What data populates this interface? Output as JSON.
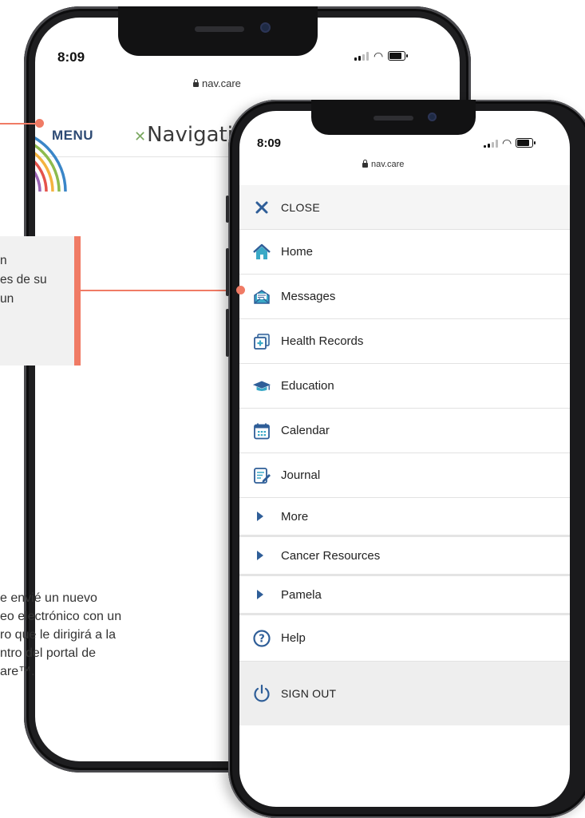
{
  "back_phone": {
    "time": "8:09",
    "url": "nav.care",
    "menu_label": "MENU",
    "logo_text": "Navigati"
  },
  "callouts": {
    "side_text_lines": [
      "n",
      "es de su",
      "un"
    ],
    "bottom_text_lines": [
      "e envié un nuevo",
      "eo electrónico con un",
      "ro que le dirigirá a la",
      "ntro del portal de",
      "are™."
    ]
  },
  "front_phone": {
    "time": "8:09",
    "url": "nav.care",
    "close_label": "CLOSE",
    "items": [
      {
        "label": "Home",
        "icon": "home-icon"
      },
      {
        "label": "Messages",
        "icon": "envelope-icon"
      },
      {
        "label": "Health Records",
        "icon": "health-records-icon"
      },
      {
        "label": "Education",
        "icon": "graduation-cap-icon"
      },
      {
        "label": "Calendar",
        "icon": "calendar-icon"
      },
      {
        "label": "Journal",
        "icon": "journal-icon"
      }
    ],
    "expandable": [
      {
        "label": "More"
      },
      {
        "label": "Cancer Resources"
      },
      {
        "label": "Pamela"
      }
    ],
    "help_label": "Help",
    "signout_label": "SIGN OUT"
  },
  "colors": {
    "accent": "#f07b65",
    "brand_navy": "#2d4a74",
    "icon_blue": "#2f5e98",
    "icon_teal": "#3aa9c7"
  }
}
